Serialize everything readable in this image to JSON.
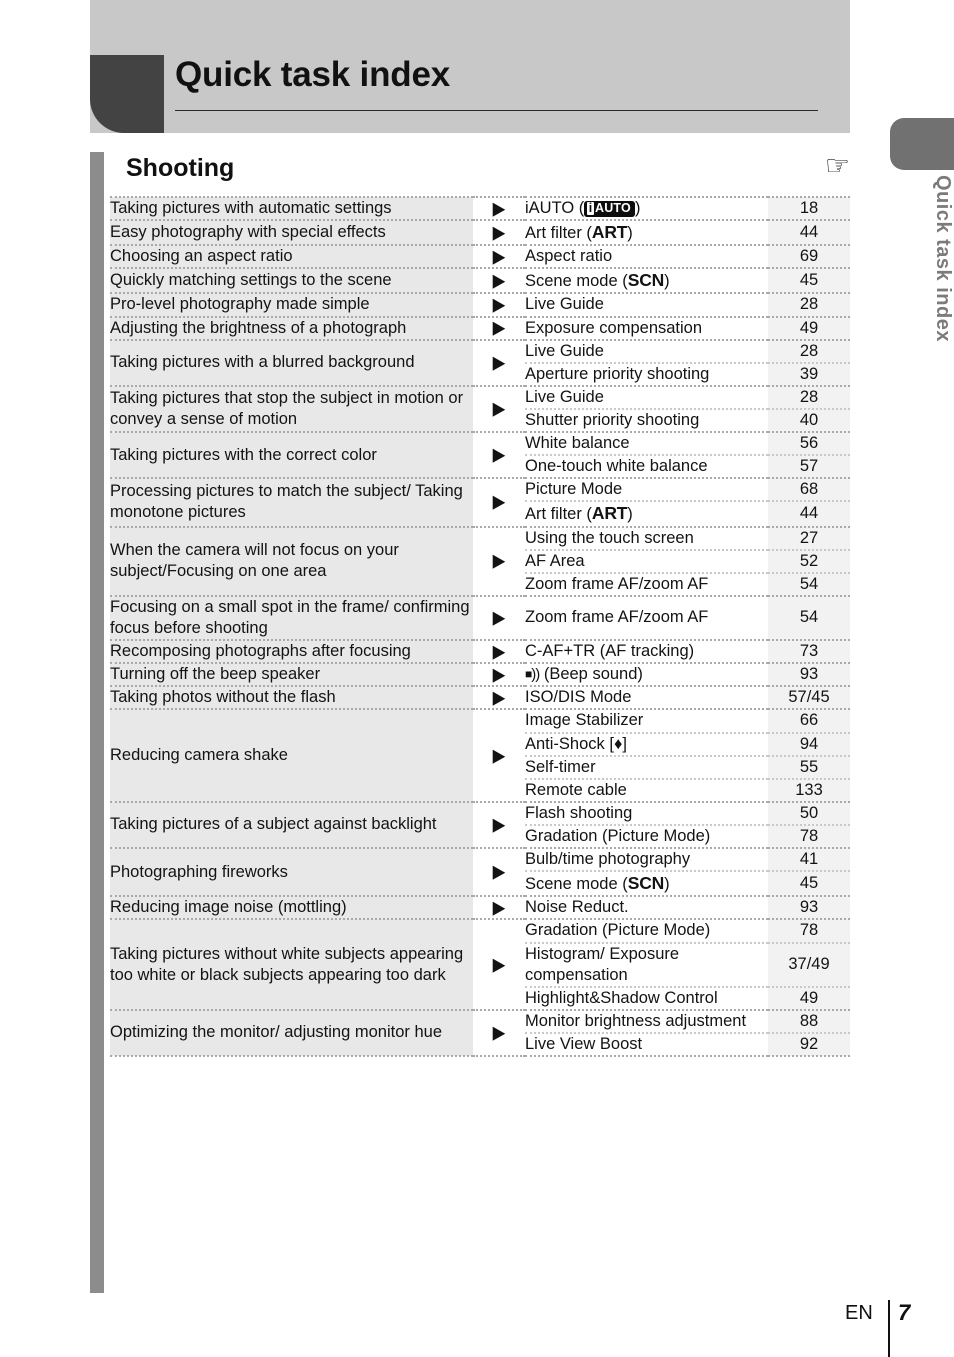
{
  "header": {
    "title": "Quick task index"
  },
  "side_tab": {
    "label": "Quick task index"
  },
  "section": {
    "title": "Shooting",
    "icon": "pointing-hand-icon",
    "icon_glyph": "☞"
  },
  "arrow_glyph": "▶",
  "rows": [
    {
      "task": "Taking pictures with automatic settings",
      "items": [
        {
          "ref": "iAUTO (",
          "ref_badge": "iAUTO",
          "ref_suffix": ")",
          "page": "18"
        }
      ]
    },
    {
      "task": "Easy photography with special effects",
      "items": [
        {
          "ref": "Art filter (",
          "ref_bold": "ART",
          "ref_suffix": ")",
          "page": "44"
        }
      ]
    },
    {
      "task": "Choosing an aspect ratio",
      "items": [
        {
          "ref": "Aspect ratio",
          "page": "69"
        }
      ]
    },
    {
      "task": "Quickly matching settings to the scene",
      "items": [
        {
          "ref": "Scene mode (",
          "ref_bold": "SCN",
          "ref_suffix": ")",
          "page": "45"
        }
      ]
    },
    {
      "task": "Pro-level photography made simple",
      "items": [
        {
          "ref": "Live Guide",
          "page": "28"
        }
      ]
    },
    {
      "task": "Adjusting the brightness of a photograph",
      "items": [
        {
          "ref": "Exposure compensation",
          "page": "49"
        }
      ]
    },
    {
      "task": "Taking pictures with a blurred background",
      "items": [
        {
          "ref": "Live Guide",
          "page": "28"
        },
        {
          "ref": "Aperture priority shooting",
          "page": "39"
        }
      ]
    },
    {
      "task": "Taking pictures that stop the subject in motion or convey a sense of motion",
      "items": [
        {
          "ref": "Live Guide",
          "page": "28"
        },
        {
          "ref": "Shutter priority shooting",
          "page": "40"
        }
      ]
    },
    {
      "task": "Taking pictures with the correct color",
      "items": [
        {
          "ref": "White balance",
          "page": "56"
        },
        {
          "ref": "One-touch white balance",
          "page": "57"
        }
      ]
    },
    {
      "task": "Processing pictures to match the subject/ Taking monotone pictures",
      "items": [
        {
          "ref": "Picture Mode",
          "page": "68"
        },
        {
          "ref": "Art filter (",
          "ref_bold": "ART",
          "ref_suffix": ")",
          "page": "44"
        }
      ]
    },
    {
      "task": "When the camera will not focus on your subject/Focusing on one area",
      "items": [
        {
          "ref": "Using the touch screen",
          "page": "27"
        },
        {
          "ref": "AF Area",
          "page": "52"
        },
        {
          "ref": "Zoom frame AF/zoom AF",
          "page": "54"
        }
      ]
    },
    {
      "task": "Focusing on a small spot in the frame/ confirming focus before shooting",
      "items": [
        {
          "ref": "Zoom frame AF/zoom AF",
          "page": "54"
        }
      ]
    },
    {
      "task": "Recomposing photographs after focusing",
      "items": [
        {
          "ref": "C-AF+TR (AF tracking)",
          "page": "73"
        }
      ]
    },
    {
      "task": "Turning off the beep speaker",
      "items": [
        {
          "ref_beep": true,
          "ref": " (Beep sound)",
          "page": "93"
        }
      ]
    },
    {
      "task": "Taking photos without the flash",
      "items": [
        {
          "ref": "ISO/DIS Mode",
          "page": "57/45"
        }
      ]
    },
    {
      "task": "Reducing camera shake",
      "items": [
        {
          "ref": "Image Stabilizer",
          "page": "66"
        },
        {
          "ref": "Anti-Shock [",
          "ref_diamond": "♦",
          "ref_suffix": "]",
          "page": "94"
        },
        {
          "ref": "Self-timer",
          "page": "55"
        },
        {
          "ref": "Remote cable",
          "page": "133"
        }
      ]
    },
    {
      "task": "Taking pictures of a subject against backlight",
      "items": [
        {
          "ref": "Flash shooting",
          "page": "50"
        },
        {
          "ref": "Gradation (Picture Mode)",
          "page": "78"
        }
      ]
    },
    {
      "task": "Photographing fireworks",
      "items": [
        {
          "ref": "Bulb/time photography",
          "page": "41"
        },
        {
          "ref": "Scene mode (",
          "ref_bold": "SCN",
          "ref_suffix": ")",
          "page": "45"
        }
      ]
    },
    {
      "task": "Reducing image noise (mottling)",
      "items": [
        {
          "ref": "Noise Reduct.",
          "page": "93"
        }
      ]
    },
    {
      "task": "Taking pictures without white subjects appearing too white or black subjects appearing too dark",
      "items": [
        {
          "ref": "Gradation (Picture Mode)",
          "page": "78"
        },
        {
          "ref": "Histogram/ Exposure compensation",
          "page": "37/49"
        },
        {
          "ref": "Highlight&Shadow Control",
          "page": "49"
        }
      ]
    },
    {
      "task": "Optimizing the monitor/ adjusting monitor hue",
      "items": [
        {
          "ref": "Monitor brightness adjustment",
          "page": "88"
        },
        {
          "ref": "Live View Boost",
          "page": "92"
        }
      ]
    }
  ],
  "footer": {
    "language": "EN",
    "page_number": "7"
  }
}
